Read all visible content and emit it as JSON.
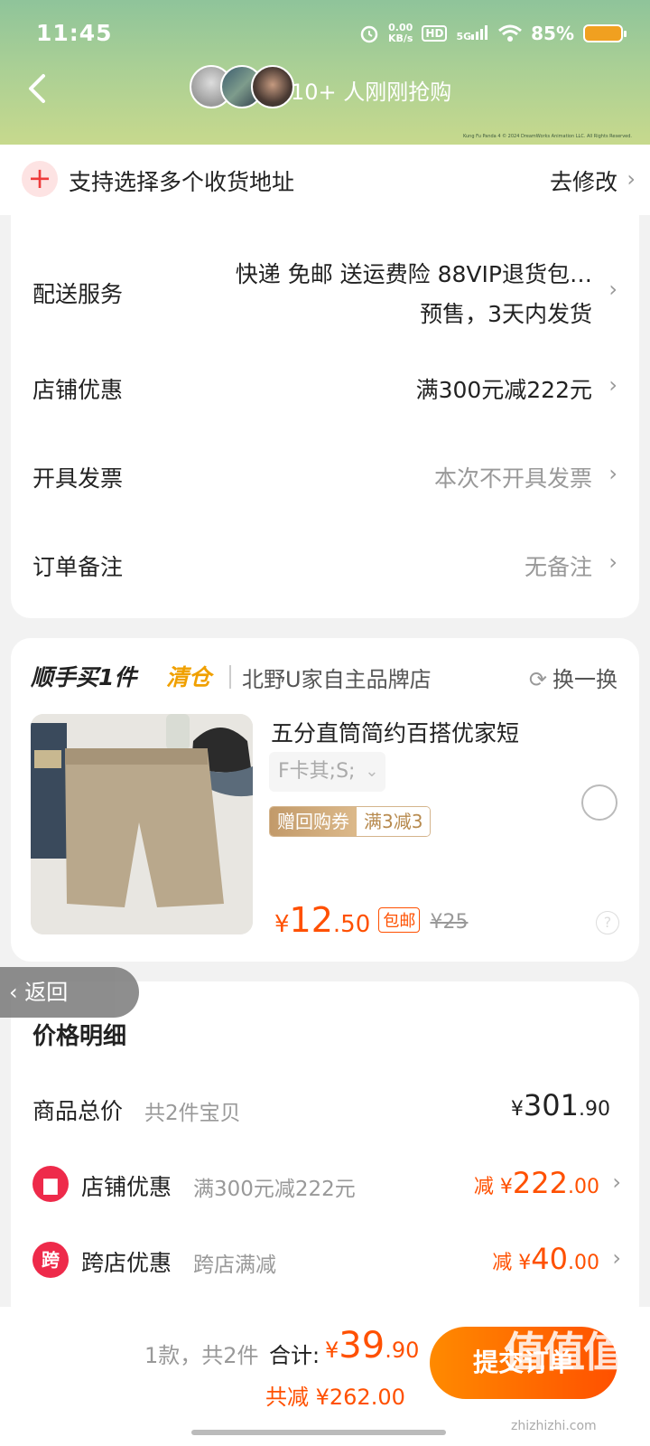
{
  "status": {
    "time": "11:45",
    "net_speed_value": "0.00",
    "net_speed_unit": "KB/s",
    "hd": "HD",
    "signal": "5G",
    "battery": "85%"
  },
  "header": {
    "buyers_text": "10+ 人刚刚抢购",
    "copyright": "Kung Fu Panda 4 © 2024 DreamWorks Animation LLC. All Rights Reserved."
  },
  "address": {
    "plus": "+",
    "text": "支持选择多个收货地址",
    "edit": "去修改"
  },
  "order": {
    "delivery_label": "配送服务",
    "delivery_line1": "快递 免邮 送运费险 88VIP退货包…",
    "delivery_line2": "预售，3天内发货",
    "shop_discount_label": "店铺优惠",
    "shop_discount_value": "满300元减222元",
    "invoice_label": "开具发票",
    "invoice_value": "本次不开具发票",
    "remark_label": "订单备注",
    "remark_value": "无备注"
  },
  "recommend": {
    "title": "顺手买1件",
    "tag": "清仓",
    "shop": "北野U家自主品牌店",
    "refresh": "换一换",
    "product_name": "五分直筒简约百搭优家短",
    "sku": "F卡其;S;",
    "coupon_a": "赠回购券",
    "coupon_b": "满3减3",
    "currency": "¥",
    "price_int": "12",
    "price_dec": ".50",
    "free_ship": "包邮",
    "orig_price": "¥25"
  },
  "float_back": "返回",
  "detail": {
    "title": "价格明细",
    "total_label": "商品总价",
    "total_sub": "共2件宝贝",
    "total_cur": "¥",
    "total_int": "301",
    "total_dec": ".90",
    "shop_label": "店铺优惠",
    "shop_sub": "满300元减222元",
    "shop_prefix": "减 ¥",
    "shop_int": "222",
    "shop_dec": ".00",
    "cross_badge": "跨",
    "cross_label": "跨店优惠",
    "cross_sub": "跨店满减",
    "cross_prefix": "减 ¥",
    "cross_int": "40",
    "cross_dec": ".00"
  },
  "bottom": {
    "count": "1款，共2件",
    "total_label": "合计:",
    "total_cur": "¥",
    "total_int": "39",
    "total_dec": ".90",
    "saved": "共减 ¥262.00",
    "submit": "提交订单",
    "watermark": "值值值",
    "watermark_url": "zhizhizhi.com"
  }
}
